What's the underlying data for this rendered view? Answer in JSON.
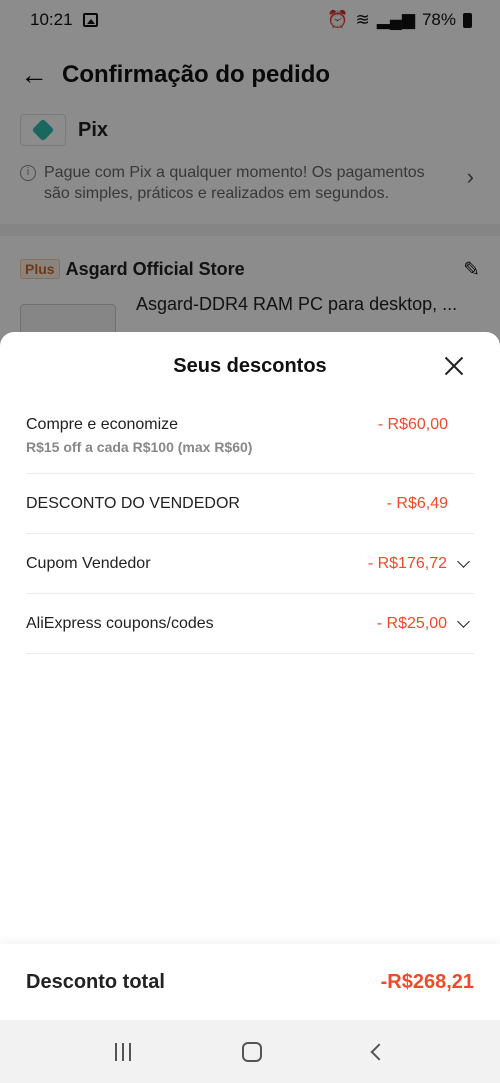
{
  "status_bar": {
    "time": "10:21",
    "battery": "78%"
  },
  "header": {
    "title": "Confirmação do pedido"
  },
  "payment": {
    "method": "Pix",
    "info": "Pague com Pix a qualquer momento! Os pagamentos são simples, práticos e realizados em segundos."
  },
  "store": {
    "badge": "Plus",
    "name": "Asgard Official Store"
  },
  "product": {
    "title": "Asgard-DDR4 RAM PC para desktop, ..."
  },
  "sheet": {
    "title": "Seus descontos",
    "discounts": [
      {
        "label": "Compre e economize",
        "sub": "R$15 off a cada R$100 (max R$60)",
        "value": "- R$60,00",
        "expandable": false
      },
      {
        "label": "DESCONTO DO VENDEDOR",
        "value": "- R$6,49",
        "expandable": false
      },
      {
        "label": "Cupom Vendedor",
        "value": "- R$176,72",
        "expandable": true
      },
      {
        "label": "AliExpress coupons/codes",
        "value": "- R$25,00",
        "expandable": true
      }
    ],
    "total_label": "Desconto total",
    "total_value": "-R$268,21"
  },
  "colors": {
    "accent": "#f04b28",
    "pix": "#32bcad"
  }
}
